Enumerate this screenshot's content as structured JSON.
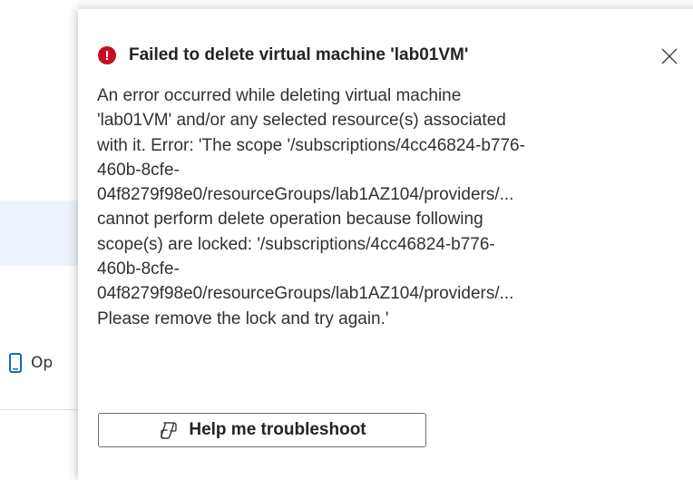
{
  "background": {
    "partial_menu_label": "Op"
  },
  "notification": {
    "title": "Failed to delete virtual machine 'lab01VM'",
    "message_lines": [
      "An error occurred while deleting virtual machine",
      "'lab01VM' and/or any selected resource(s) associated",
      "with it. Error: 'The scope '/subscriptions/4cc46824-b776-",
      "460b-8cfe-",
      "04f8279f98e0/resourceGroups/lab1AZ104/providers/...",
      "cannot perform delete operation because following",
      "scope(s) are locked: '/subscriptions/4cc46824-b776-",
      "460b-8cfe-",
      "04f8279f98e0/resourceGroups/lab1AZ104/providers/...",
      "Please remove the lock and try again.'"
    ],
    "help_button_label": "Help me troubleshoot",
    "icons": {
      "status": "error-icon",
      "close": "close-icon",
      "help": "copilot-icon"
    },
    "colors": {
      "error": "#c50f1f",
      "text": "#323130",
      "title": "#242424"
    }
  }
}
